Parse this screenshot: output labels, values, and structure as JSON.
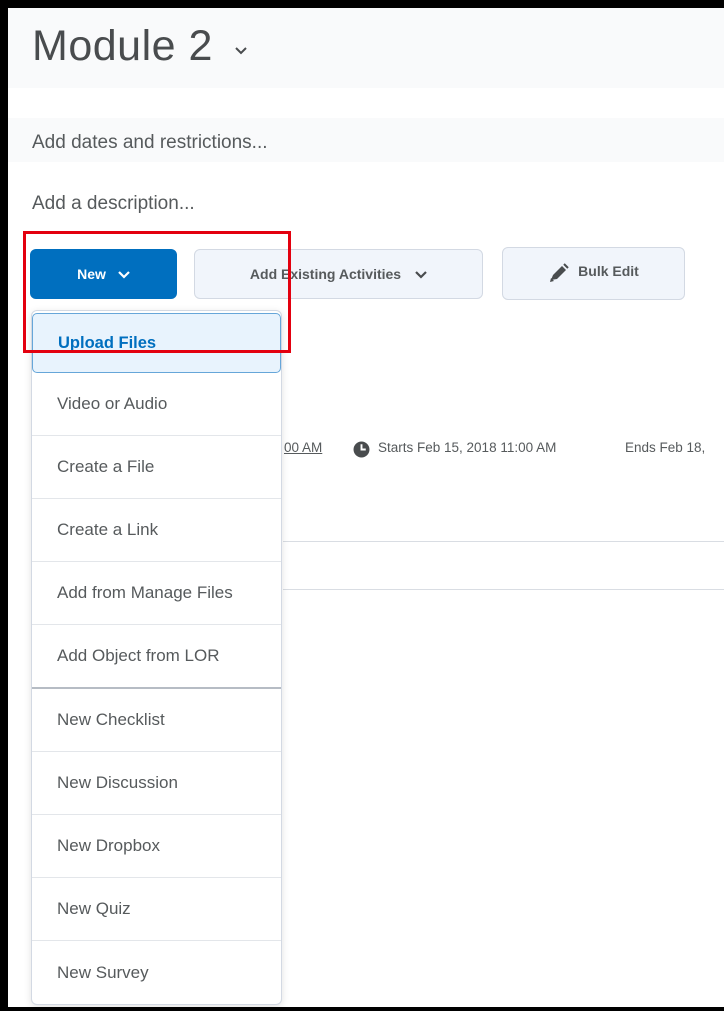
{
  "module": {
    "title": "Module 2"
  },
  "links": {
    "dates": "Add dates and restrictions...",
    "description": "Add a description..."
  },
  "toolbar": {
    "new_label": "New",
    "existing_label": "Add Existing Activities",
    "bulk_label": "Bulk Edit"
  },
  "item_info": {
    "time_fragment": "00 AM",
    "starts": "Starts Feb 15, 2018 11:00 AM",
    "ends": "Ends Feb 18,"
  },
  "new_menu": {
    "items": [
      {
        "label": "Upload Files"
      },
      {
        "label": "Video or Audio"
      },
      {
        "label": "Create a File"
      },
      {
        "label": "Create a Link"
      },
      {
        "label": "Add from Manage Files"
      },
      {
        "label": "Add Object from LOR"
      },
      {
        "label": "New Checklist"
      },
      {
        "label": "New Discussion"
      },
      {
        "label": "New Dropbox"
      },
      {
        "label": "New Quiz"
      },
      {
        "label": "New Survey"
      }
    ]
  },
  "colors": {
    "primary": "#006fbf",
    "highlight": "#e3000f"
  },
  "icons": {
    "title_chevron": "chevron-down-icon",
    "bulk": "pencil-icon",
    "clock": "clock-icon"
  }
}
